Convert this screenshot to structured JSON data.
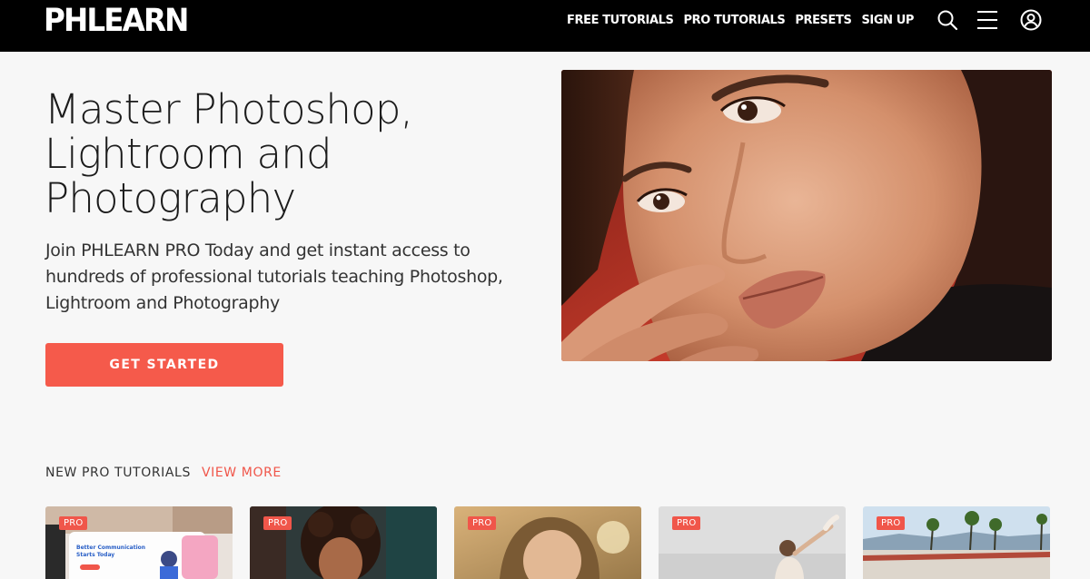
{
  "header": {
    "logo": "PHLEARN",
    "nav": [
      {
        "label": "FREE TUTORIALS"
      },
      {
        "label": "PRO TUTORIALS"
      },
      {
        "label": "PRESETS"
      },
      {
        "label": "SIGN UP"
      }
    ],
    "icons": [
      "search-icon",
      "menu-icon",
      "account-icon"
    ]
  },
  "hero": {
    "title_lines": [
      "Master Photoshop,",
      "Lightroom and",
      "Photography"
    ],
    "description_lines": [
      "Join PHLEARN PRO Today and get instant access to",
      "hundreds of professional tutorials teaching Photoshop,",
      "Lightroom and Photography"
    ],
    "cta_label": "GET STARTED"
  },
  "section": {
    "title": "NEW PRO TUTORIALS",
    "view_more": "VIEW MORE"
  },
  "cards": [
    {
      "badge": "PRO",
      "text": "Better Communication Starts Today"
    },
    {
      "badge": "PRO"
    },
    {
      "badge": "PRO"
    },
    {
      "badge": "PRO"
    },
    {
      "badge": "PRO"
    }
  ],
  "colors": {
    "accent": "#f55a4b",
    "header_bg": "#000000",
    "page_bg": "#f7f7f7"
  }
}
